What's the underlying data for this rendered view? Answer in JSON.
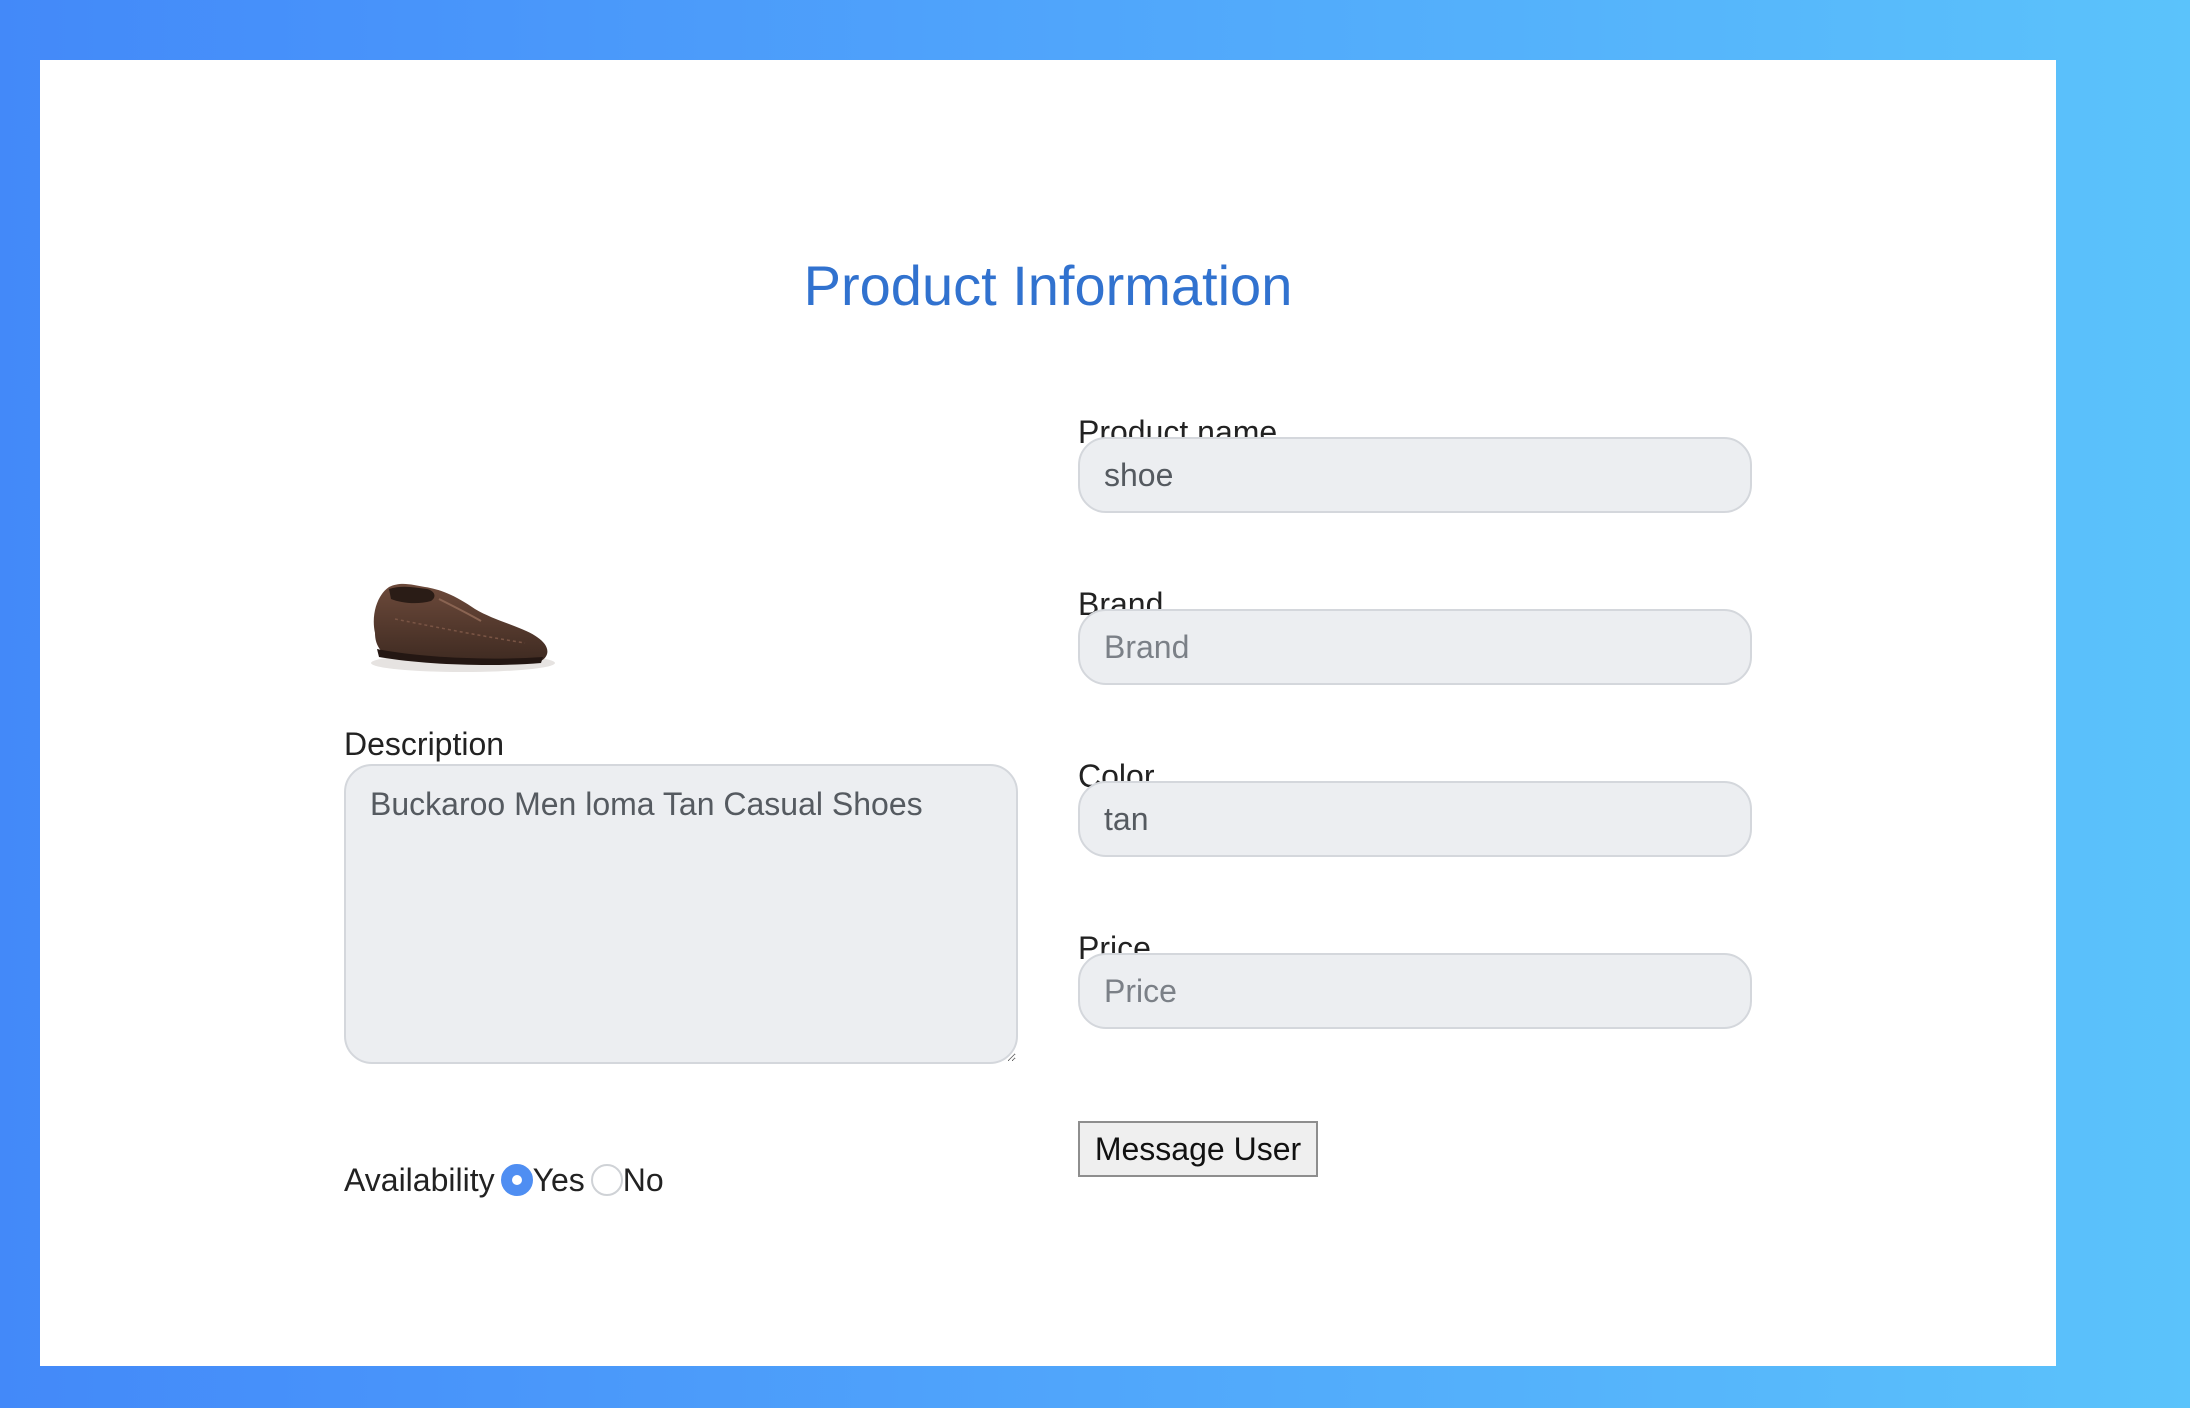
{
  "page": {
    "title": "Product Information"
  },
  "product_image": {
    "icon": "brown-shoe-image"
  },
  "form": {
    "description": {
      "label": "Description",
      "value": "Buckaroo Men loma Tan Casual Shoes"
    },
    "availability": {
      "label": "Availability",
      "options": [
        {
          "label": "Yes",
          "selected": true
        },
        {
          "label": "No",
          "selected": false
        }
      ]
    },
    "product_name": {
      "label": "Product name",
      "value": "shoe",
      "placeholder": ""
    },
    "brand": {
      "label": "Brand",
      "value": "",
      "placeholder": "Brand"
    },
    "color": {
      "label": "Color",
      "value": "tan",
      "placeholder": ""
    },
    "price": {
      "label": "Price",
      "value": "",
      "placeholder": "Price"
    },
    "message_button": {
      "label": "Message User"
    }
  },
  "colors": {
    "background_start": "#4389f9",
    "background_end": "#5bc3fb",
    "title": "#3172cf",
    "input_background": "#eceef1",
    "radio_selected": "#4f8ef2"
  }
}
